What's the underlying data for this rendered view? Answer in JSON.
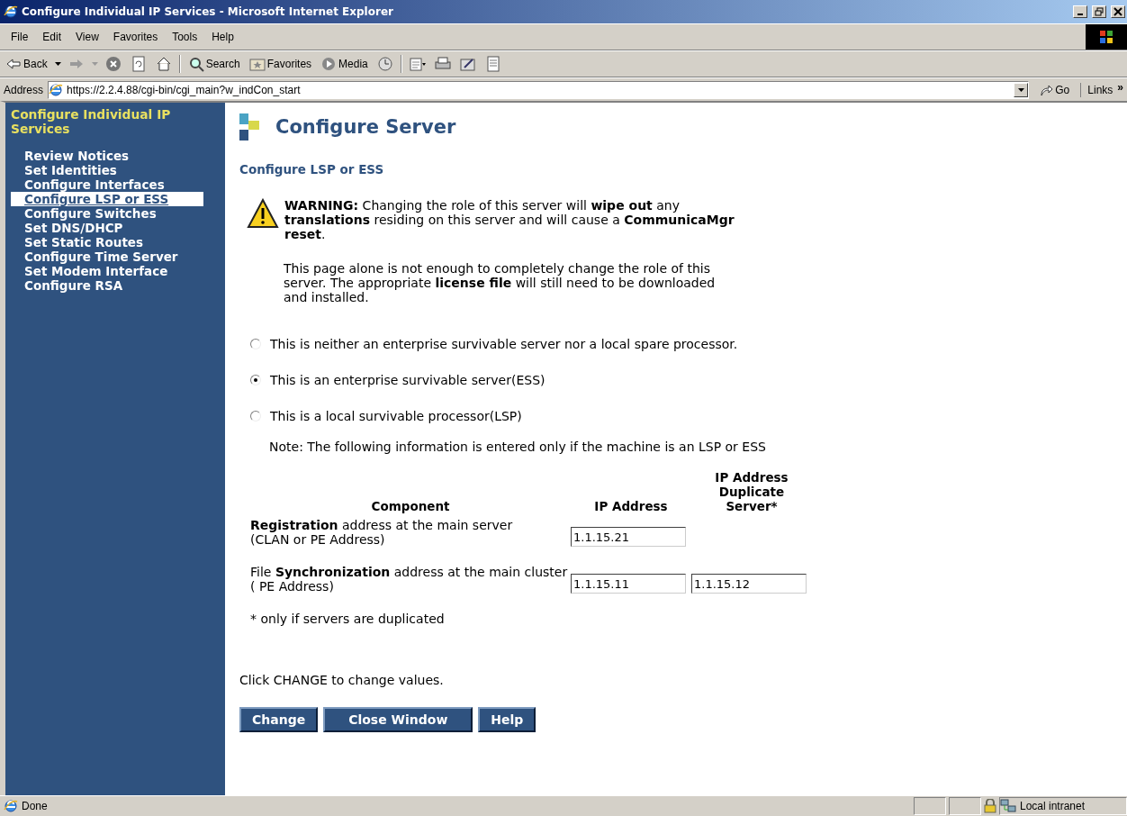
{
  "window": {
    "title": "Configure Individual IP Services - Microsoft Internet Explorer"
  },
  "menu": [
    "File",
    "Edit",
    "View",
    "Favorites",
    "Tools",
    "Help"
  ],
  "toolbar": {
    "back": "Back",
    "search": "Search",
    "favorites": "Favorites",
    "media": "Media"
  },
  "address_bar": {
    "label": "Address",
    "url": "https://2.2.4.88/cgi-bin/cgi_main?w_indCon_start",
    "go": "Go",
    "links": "Links",
    "more": "»"
  },
  "sidebar": {
    "title": "Configure Individual IP Services",
    "items": [
      {
        "label": "Review Notices",
        "selected": false
      },
      {
        "label": "Set Identities",
        "selected": false
      },
      {
        "label": "Configure Interfaces",
        "selected": false
      },
      {
        "label": "Configure LSP or ESS",
        "selected": true
      },
      {
        "label": "Configure Switches",
        "selected": false
      },
      {
        "label": "Set DNS/DHCP",
        "selected": false
      },
      {
        "label": "Set Static Routes",
        "selected": false
      },
      {
        "label": "Configure Time Server",
        "selected": false
      },
      {
        "label": "Set Modem Interface",
        "selected": false
      },
      {
        "label": "Configure RSA",
        "selected": false
      }
    ]
  },
  "main": {
    "heading": "Configure Server",
    "subheading": "Configure LSP or ESS",
    "warning": "**WARNING:** Changing the role of this server will **wipe out** any **translations** residing on this server and will cause a **CommunicaMgr reset**.",
    "info": "This page alone is not enough to completely change the role of this server. The appropriate **license file** will still need to be downloaded and installed.",
    "options": [
      {
        "label": "This is neither an enterprise survivable server nor a local spare processor.",
        "selected": false
      },
      {
        "label": "This is an enterprise survivable server(ESS)",
        "selected": true
      },
      {
        "label": "This is a local survivable processor(LSP)",
        "selected": false
      }
    ],
    "note": "Note: The following information is entered only if the machine is an LSP or ESS",
    "table": {
      "columns": [
        "Component",
        "IP Address",
        "IP Address Duplicate Server*"
      ],
      "rows": [
        {
          "lines": [
            "**Registration** address at the main server",
            "(CLAN or PE Address)"
          ],
          "values": [
            "1.1.15.21"
          ]
        },
        {
          "lines": [
            "File **Synchronization** address at the main cluster",
            "( PE Address)"
          ],
          "values": [
            "1.1.15.11",
            "1.1.15.12"
          ]
        }
      ]
    },
    "footnote": "* only if servers are duplicated",
    "instruction": "Click CHANGE to change values.",
    "buttons": [
      "Change",
      "Close Window",
      "Help"
    ]
  },
  "status_bar": {
    "text": "Done",
    "zone": "Local intranet"
  }
}
